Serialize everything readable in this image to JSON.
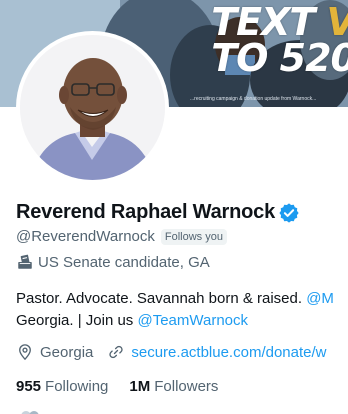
{
  "banner": {
    "headline_line1_a": "TEXT ",
    "headline_line1_b": "V",
    "headline_line2": "TO 520",
    "caption": "...recruiting campaign & donation update from Warnock..."
  },
  "profile": {
    "display_name": "Reverend Raphael Warnock",
    "handle": "@ReverendWarnock",
    "follows_you": "Follows you",
    "category": "US Senate candidate, GA",
    "bio_line1_text": "Pastor. Advocate. Savannah born & raised. ",
    "bio_line1_link": "@M",
    "bio_line2_text": "Georgia. | Join us ",
    "bio_line2_link": "@TeamWarnock",
    "location": "Georgia",
    "website": "secure.actblue.com/donate/w",
    "following_count": "955",
    "following_label": "Following",
    "followers_count": "1M",
    "followers_label": "Followers"
  },
  "colors": {
    "accent": "#1d9bf0",
    "secondary_text": "#536471",
    "primary_text": "#0f1419",
    "banner_highlight": "#e3b43a"
  },
  "icons": {
    "verified": "verified-badge-icon",
    "category": "ballot-box-icon",
    "location": "location-pin-icon",
    "website": "link-icon"
  }
}
